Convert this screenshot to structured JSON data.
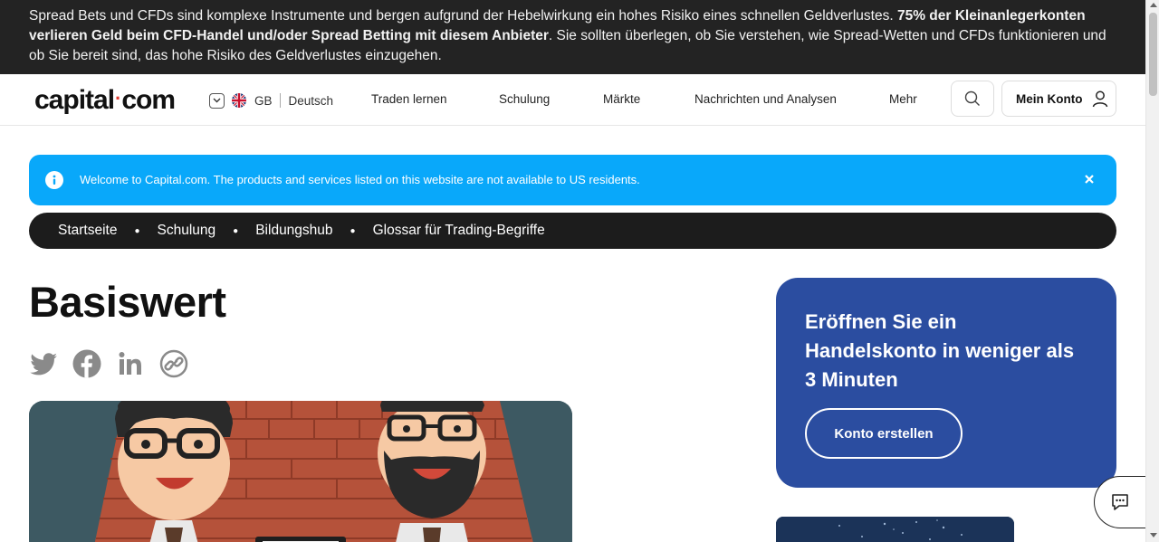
{
  "risk_warning": {
    "text_1": "Spread Bets und CFDs sind komplexe Instrumente und bergen aufgrund der Hebelwirkung ein hohes Risiko eines schnellen Geldverlustes. ",
    "bold": "75% der Kleinanlegerkonten verlieren Geld beim CFD-Handel und/oder Spread Betting mit diesem Anbieter",
    "text_2": ". Sie sollten überlegen, ob Sie verstehen, wie Spread-Wetten und CFDs funktionieren und ob Sie bereit sind, das hohe Risiko des Geldverlustes einzugehen."
  },
  "header": {
    "logo_left": "capital",
    "logo_dot": "·",
    "logo_right": "com",
    "region": "GB",
    "language": "Deutsch",
    "nav": [
      "Traden lernen",
      "Schulung",
      "Märkte",
      "Nachrichten und Analysen",
      "Mehr"
    ],
    "account_label": "Mein Konto"
  },
  "us_banner": {
    "message": "Welcome to Capital.com. The products and services listed on this website are not available to US residents."
  },
  "breadcrumb": [
    "Startseite",
    "Schulung",
    "Bildungshub",
    "Glossar für Trading-Begriffe"
  ],
  "page": {
    "title": "Basiswert"
  },
  "cta": {
    "heading": "Eröffnen Sie ein Handelskonto in weniger als 3 Minuten",
    "button": "Konto erstellen"
  },
  "icons": {
    "share": [
      "twitter-icon",
      "facebook-icon",
      "linkedin-icon",
      "copy-link-icon"
    ],
    "colors": {
      "banner_blue": "#09a8fa",
      "cta_blue": "#2b4da0",
      "share_gray": "#8a8a8a",
      "dark": "#232323"
    }
  }
}
